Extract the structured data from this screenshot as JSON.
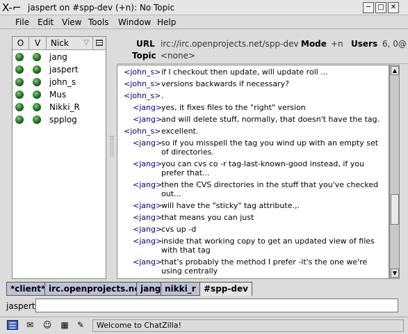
{
  "window": {
    "app_icon": "X-⌐",
    "title": "jaspert on #spp-dev (+n): No Topic",
    "buttons": [
      "─",
      "□",
      "✕"
    ]
  },
  "menu": [
    "File",
    "Edit",
    "View",
    "Tools",
    "Window",
    "Help"
  ],
  "userlist": {
    "headers": {
      "op": "O",
      "voice": "V",
      "nick": "Nick"
    },
    "users": [
      "jang",
      "jaspert",
      "john_s",
      "Mus",
      "Nikki_R",
      "spplog"
    ]
  },
  "channel": {
    "url_label": "URL",
    "url": "irc://irc.openprojects.net/spp-dev",
    "mode_label": "Mode",
    "mode": "+n",
    "users_label": "Users",
    "users": "6, 0@",
    "topic_label": "Topic",
    "topic": "<none>"
  },
  "messages": [
    {
      "nick": "<john_s>",
      "text": "if I checkout then update, will update roll ..."
    },
    {
      "nick": "<john_s>",
      "text": "versions backwards if necessary?"
    },
    {
      "nick": "<john_s>",
      "text": "."
    },
    {
      "nick": "<jang>",
      "text": "yes, it fixes files to the \"right\" version"
    },
    {
      "nick": "<jang>",
      "text": "and will delete stuff, normally, that doesn't have the tag."
    },
    {
      "nick": "<john_s>",
      "text": "excellent."
    },
    {
      "nick": "<jang>",
      "text": "so if you misspell the tag you wind up with an empty set of directories."
    },
    {
      "nick": "<jang>",
      "text": "you can cvs co -r tag-last-known-good instead, if you prefer that..."
    },
    {
      "nick": "<jang>",
      "text": "then the CVS directories in the stuff that you've checked out..."
    },
    {
      "nick": "<jang>",
      "text": "will have the \"sticky\" tag attribute.,."
    },
    {
      "nick": "<jang>",
      "text": "that means you can just"
    },
    {
      "nick": "<jang>",
      "text": "cvs up -d"
    },
    {
      "nick": "<jang>",
      "text": "inside that working copy to get an updated view of files with that tag"
    },
    {
      "nick": "<jang>",
      "text": "that's probably the method I prefer -it's the one we're using centrally"
    }
  ],
  "tabs": [
    "*client*",
    "irc.openprojects.net",
    "jang",
    "nikki_r",
    "#spp-dev"
  ],
  "input": {
    "nick": "jaspert",
    "value": ""
  },
  "status": {
    "text": "Welcome to ChatZilla!"
  }
}
